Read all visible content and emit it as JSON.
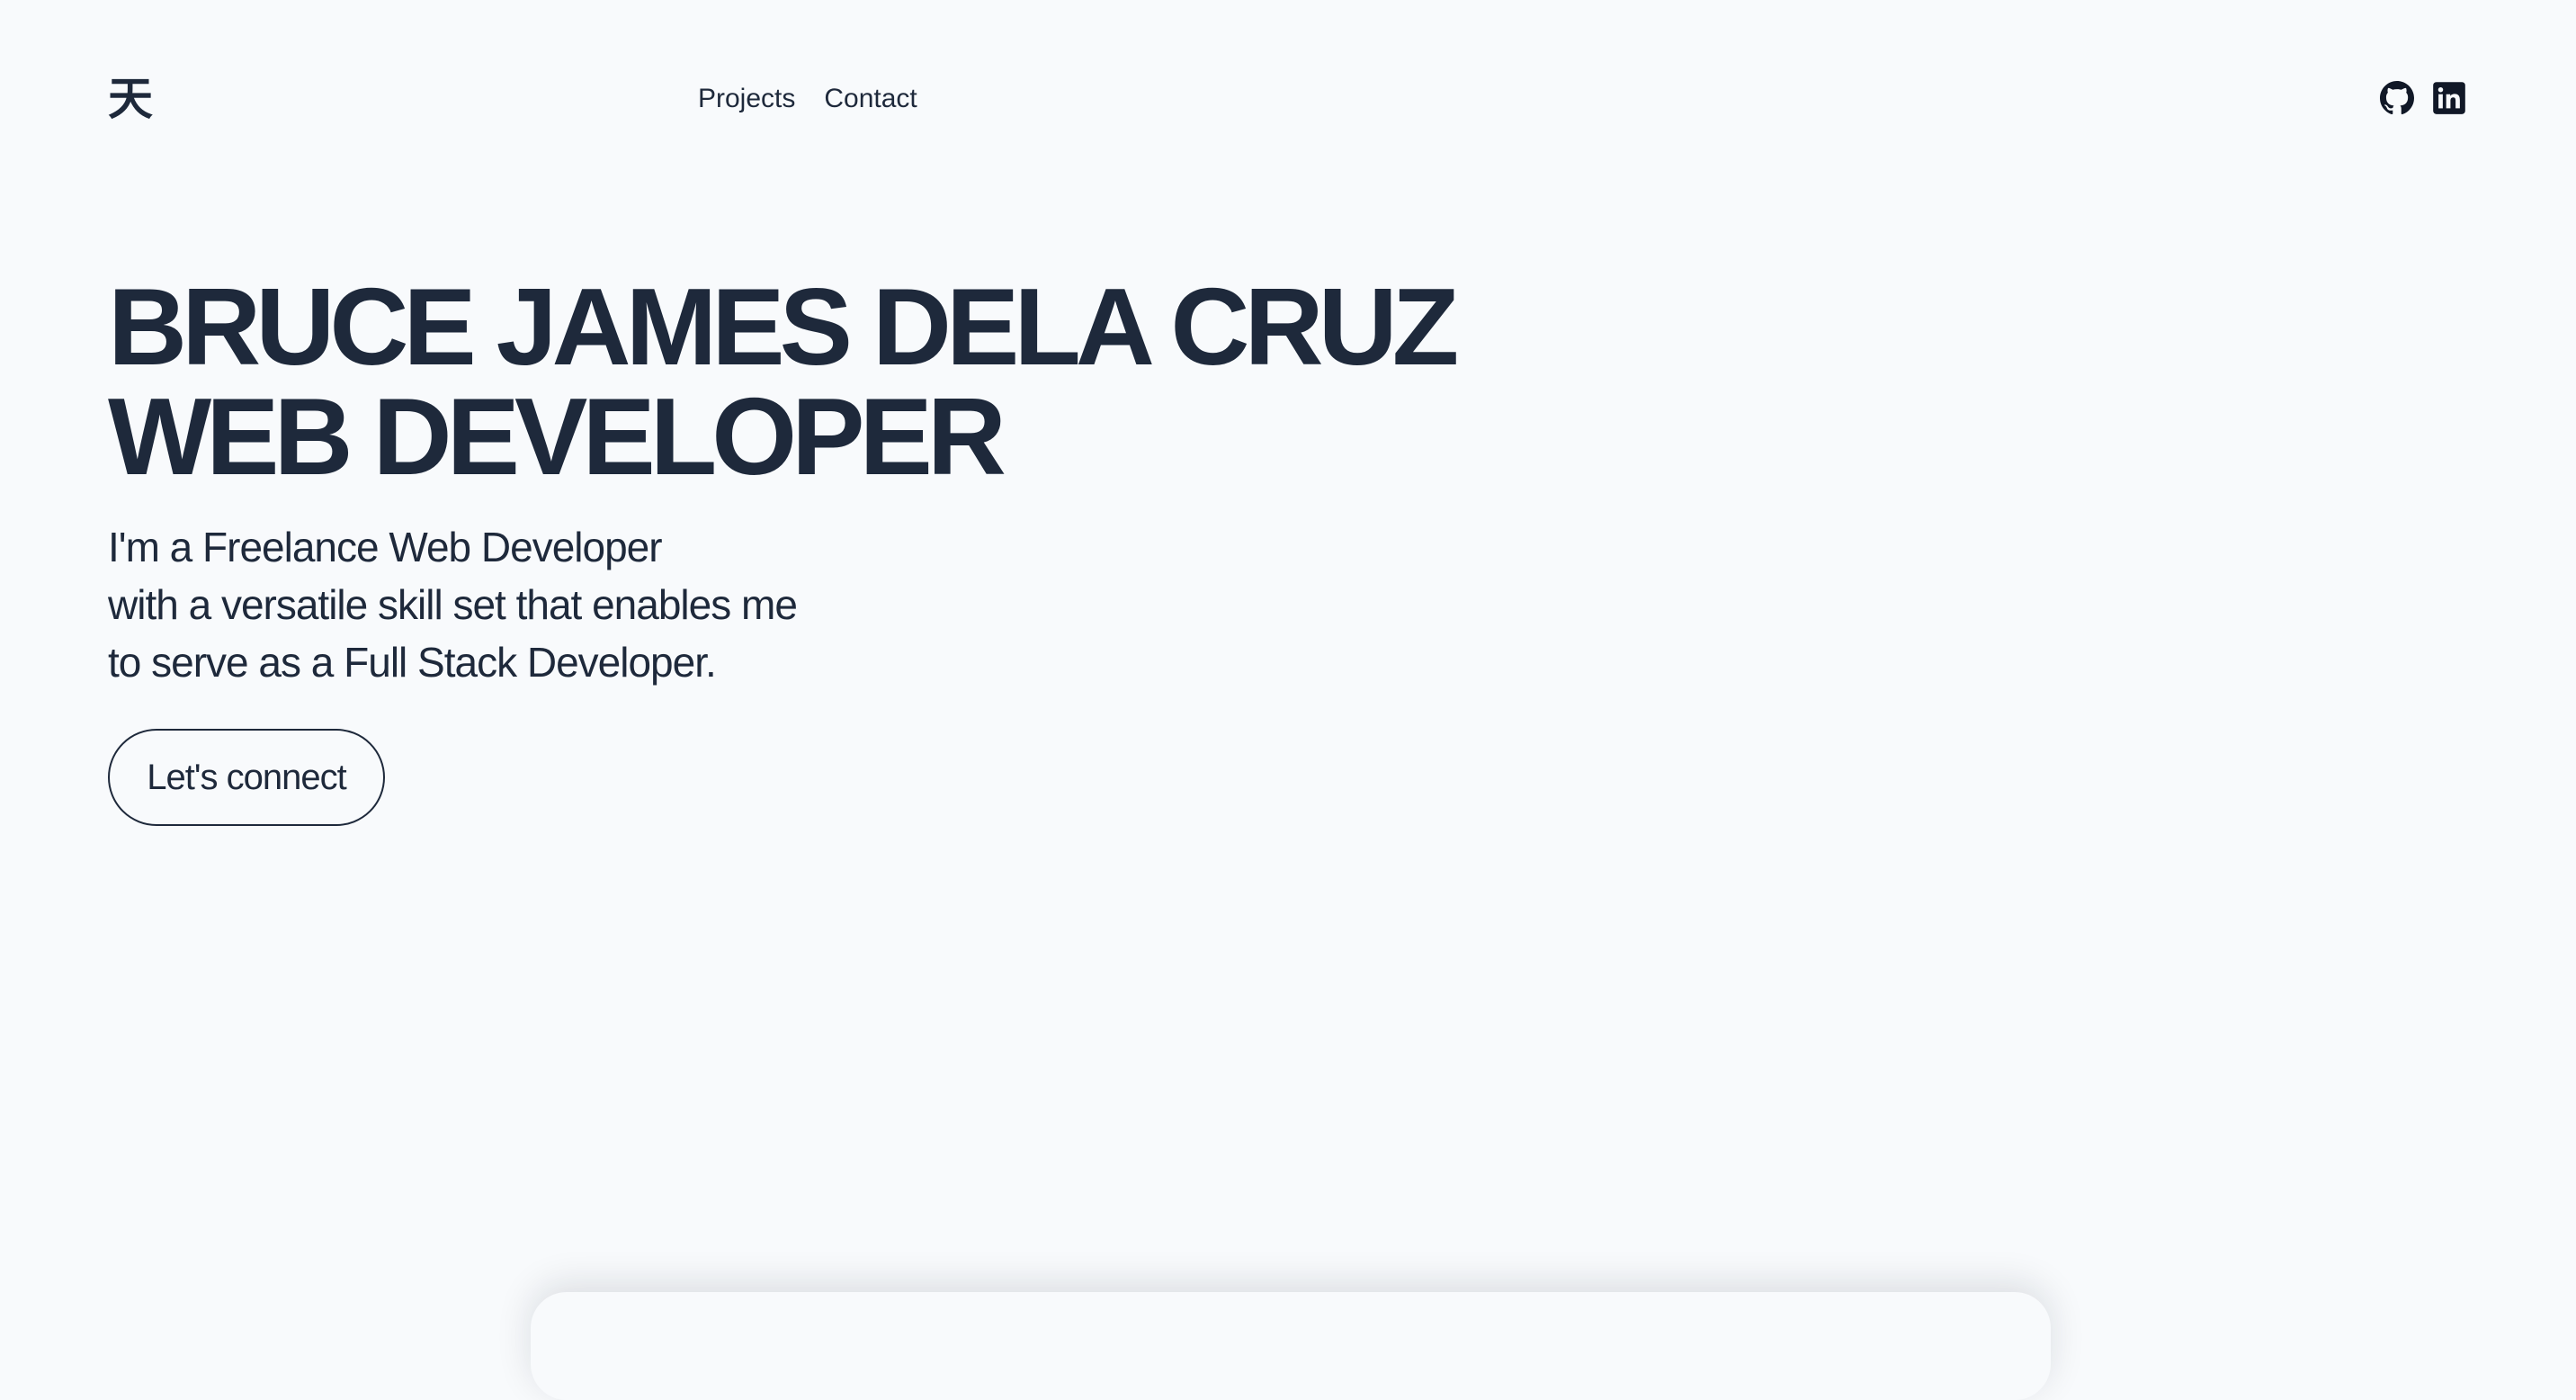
{
  "header": {
    "logo": "天",
    "nav": [
      {
        "label": "Projects"
      },
      {
        "label": "Contact"
      }
    ],
    "social": [
      {
        "icon": "github-icon"
      },
      {
        "icon": "linkedin-icon"
      }
    ]
  },
  "hero": {
    "title_line1": "BRUCE JAMES DELA CRUZ",
    "title_line2": "WEB DEVELOPER",
    "description": [
      "I'm a Freelance Web Developer",
      "with a versatile skill set that enables me",
      "to serve as a Full Stack Developer."
    ],
    "cta_label": "Let's connect"
  },
  "colors": {
    "background": "#f8fafc",
    "text": "#1e293b"
  }
}
